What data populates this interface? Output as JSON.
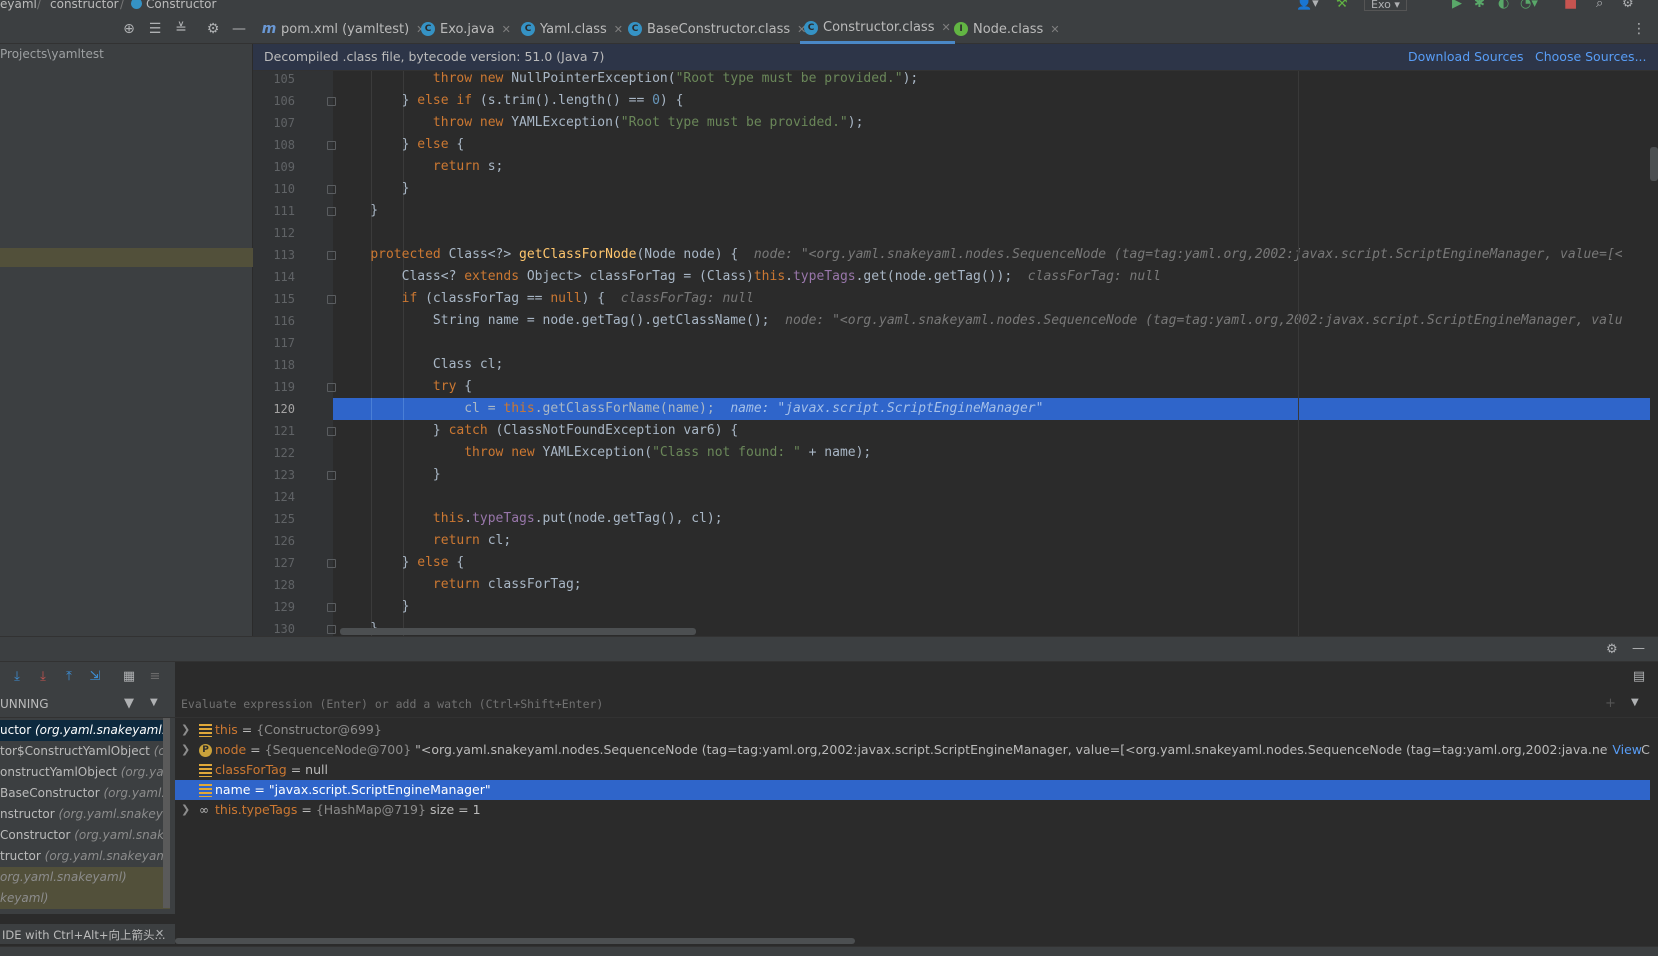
{
  "breadcrumb": [
    "eyaml",
    "constructor",
    "Constructor"
  ],
  "tabs": [
    {
      "label": "pom.xml (yamltest)",
      "icon": "m"
    },
    {
      "label": "Exo.java",
      "icon": "C"
    },
    {
      "label": "Yaml.class",
      "icon": "C"
    },
    {
      "label": "BaseConstructor.class",
      "icon": "C"
    },
    {
      "label": "Constructor.class",
      "icon": "C",
      "active": true
    },
    {
      "label": "Node.class",
      "icon": "I"
    }
  ],
  "run_config": "Exo",
  "project_path": "Projects\\yamltest",
  "info_bar": {
    "message": "Decompiled .class file, bytecode version: 51.0 (Java 7)",
    "download_sources": "Download Sources",
    "choose_sources": "Choose Sources..."
  },
  "code_lines": [
    {
      "n": "105",
      "parts": [
        [
          "",
          "            "
        ],
        [
          "kw",
          "throw new "
        ],
        [
          "",
          "NullPointerException("
        ],
        [
          "str",
          "\"Root type must be provided.\""
        ],
        [
          "",
          ");"
        ]
      ]
    },
    {
      "n": "106",
      "parts": [
        [
          "",
          "        } "
        ],
        [
          "kw",
          "else if "
        ],
        [
          "",
          "(s.trim().length() == "
        ],
        [
          "num",
          "0"
        ],
        [
          "",
          ") {"
        ]
      ]
    },
    {
      "n": "107",
      "parts": [
        [
          "",
          "            "
        ],
        [
          "kw",
          "throw new "
        ],
        [
          "",
          "YAMLException("
        ],
        [
          "str",
          "\"Root type must be provided.\""
        ],
        [
          "",
          ");"
        ]
      ]
    },
    {
      "n": "108",
      "parts": [
        [
          "",
          "        } "
        ],
        [
          "kw",
          "else "
        ],
        [
          "",
          "{"
        ]
      ]
    },
    {
      "n": "109",
      "parts": [
        [
          "",
          "            "
        ],
        [
          "kw",
          "return "
        ],
        [
          "",
          "s;"
        ]
      ]
    },
    {
      "n": "110",
      "parts": [
        [
          "",
          "        }"
        ]
      ]
    },
    {
      "n": "111",
      "parts": [
        [
          "",
          "    }"
        ]
      ]
    },
    {
      "n": "112",
      "parts": [
        [
          "",
          ""
        ]
      ]
    },
    {
      "n": "113",
      "parts": [
        [
          "",
          "    "
        ],
        [
          "kw",
          "protected "
        ],
        [
          "",
          "Class<?> "
        ],
        [
          "fn",
          "getClassForNode"
        ],
        [
          "",
          "(Node node) {  "
        ],
        [
          "hint",
          "node: \"<org.yaml.snakeyaml.nodes.SequenceNode (tag=tag:yaml.org,2002:javax.script.ScriptEngineManager, value=[<"
        ]
      ]
    },
    {
      "n": "114",
      "parts": [
        [
          "",
          "        Class<? "
        ],
        [
          "kw",
          "extends "
        ],
        [
          "",
          "Object> classForTag = (Class)"
        ],
        [
          "kw",
          "this"
        ],
        [
          "",
          "."
        ],
        [
          "fld",
          "typeTags"
        ],
        [
          "",
          ".get(node.getTag());  "
        ],
        [
          "hint",
          "classForTag: null"
        ]
      ]
    },
    {
      "n": "115",
      "parts": [
        [
          "",
          "        "
        ],
        [
          "kw",
          "if "
        ],
        [
          "",
          "(classForTag == "
        ],
        [
          "kw",
          "null"
        ],
        [
          "",
          ") {  "
        ],
        [
          "hint",
          "classForTag: null"
        ]
      ]
    },
    {
      "n": "116",
      "parts": [
        [
          "",
          "            String name = node.getTag().getClassName();  "
        ],
        [
          "hint",
          "node: \"<org.yaml.snakeyaml.nodes.SequenceNode (tag=tag:yaml.org,2002:javax.script.ScriptEngineManager, valu"
        ]
      ]
    },
    {
      "n": "117",
      "parts": [
        [
          "",
          ""
        ]
      ]
    },
    {
      "n": "118",
      "parts": [
        [
          "",
          "            Class cl;"
        ]
      ]
    },
    {
      "n": "119",
      "parts": [
        [
          "",
          "            "
        ],
        [
          "kw",
          "try "
        ],
        [
          "",
          "{"
        ]
      ]
    },
    {
      "n": "120",
      "current": true,
      "parts": [
        [
          "",
          "                cl = "
        ],
        [
          "kw",
          "this"
        ],
        [
          "",
          ".getClassForName(name);  "
        ],
        [
          "hint",
          "name: \"javax.script.ScriptEngineManager\""
        ]
      ]
    },
    {
      "n": "121",
      "parts": [
        [
          "",
          "            } "
        ],
        [
          "kw",
          "catch "
        ],
        [
          "",
          "(ClassNotFoundException var6) {"
        ]
      ]
    },
    {
      "n": "122",
      "parts": [
        [
          "",
          "                "
        ],
        [
          "kw",
          "throw new "
        ],
        [
          "",
          "YAMLException("
        ],
        [
          "str",
          "\"Class not found: \""
        ],
        [
          "",
          " + name);"
        ]
      ]
    },
    {
      "n": "123",
      "parts": [
        [
          "",
          "            }"
        ]
      ]
    },
    {
      "n": "124",
      "parts": [
        [
          "",
          ""
        ]
      ]
    },
    {
      "n": "125",
      "parts": [
        [
          "",
          "            "
        ],
        [
          "kw",
          "this"
        ],
        [
          "",
          "."
        ],
        [
          "fld",
          "typeTags"
        ],
        [
          "",
          ".put(node.getTag(), cl);"
        ]
      ]
    },
    {
      "n": "126",
      "parts": [
        [
          "",
          "            "
        ],
        [
          "kw",
          "return "
        ],
        [
          "",
          "cl;"
        ]
      ]
    },
    {
      "n": "127",
      "parts": [
        [
          "",
          "        } "
        ],
        [
          "kw",
          "else "
        ],
        [
          "",
          "{"
        ]
      ]
    },
    {
      "n": "128",
      "parts": [
        [
          "",
          "            "
        ],
        [
          "kw",
          "return "
        ],
        [
          "",
          "classForTag;"
        ]
      ]
    },
    {
      "n": "129",
      "parts": [
        [
          "",
          "        }"
        ]
      ]
    },
    {
      "n": "130",
      "parts": [
        [
          "",
          "    }"
        ]
      ]
    }
  ],
  "debugger": {
    "thread_label": "UNNING",
    "eval_placeholder": "Evaluate expression (Enter) or add a watch (Ctrl+Shift+Enter)",
    "frames": [
      {
        "method": "uctor ",
        "cls": "(org.yaml.snakeyaml.co",
        "selected": true
      },
      {
        "method": "tor$ConstructYamlObject ",
        "cls": "(org.y"
      },
      {
        "method": "onstructYamlObject ",
        "cls": "(org.yaml."
      },
      {
        "method": " BaseConstructor ",
        "cls": "(org.yaml.s"
      },
      {
        "method": "nstructor ",
        "cls": "(org.yaml.snakeyaml"
      },
      {
        "method": "Constructor ",
        "cls": "(org.yaml.snakey"
      },
      {
        "method": "tructor ",
        "cls": "(org.yaml.snakeyaml.c"
      },
      {
        "method": "",
        "cls": "org.yaml.snakeyaml)",
        "lib": true
      },
      {
        "method": "",
        "cls": "keyaml)",
        "lib": true
      }
    ],
    "variables": [
      {
        "expand": true,
        "icon": "field",
        "name": "this",
        "eq": " = ",
        "val": "{Constructor@699}",
        "rest": ""
      },
      {
        "expand": true,
        "icon": "param",
        "name": "node",
        "eq": " = ",
        "val": "{SequenceNode@700} ",
        "rest": "\"<org.yaml.snakeyaml.nodes.SequenceNode (tag=tag:yaml.org,2002:javax.script.ScriptEngineManager, value=[<org.yaml.snakeyaml.nodes.SequenceNode (tag=tag:yaml.org,2002:java.net.URLClassLoader, val...",
        "view": "View"
      },
      {
        "expand": false,
        "icon": "field",
        "name": "classForTag",
        "eq": " = ",
        "val": "",
        "rest": "null"
      },
      {
        "expand": false,
        "icon": "field",
        "name": "name",
        "eq": " = ",
        "val": "",
        "rest": "\"javax.script.ScriptEngineManager\"",
        "selected": true
      },
      {
        "expand": true,
        "icon": "watch",
        "name": "this.typeTags",
        "eq": " = ",
        "val": "{HashMap@719} ",
        "rest": " size = 1"
      }
    ],
    "status_hint": "IDE with Ctrl+Alt+向上箭头..."
  }
}
